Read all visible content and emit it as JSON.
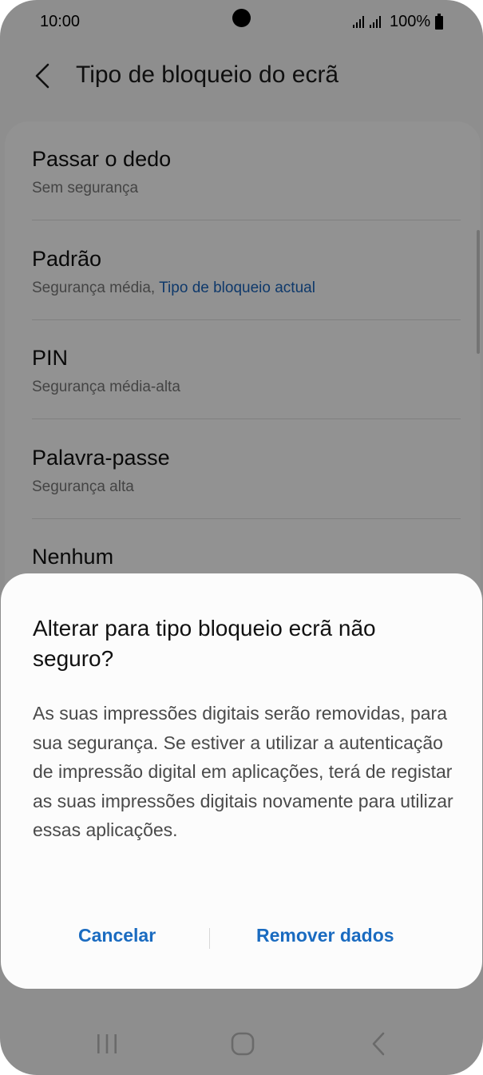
{
  "status_bar": {
    "time": "10:00",
    "battery_text": "100%",
    "icons": [
      "camera-cutout",
      "signal-icon",
      "battery-icon"
    ]
  },
  "app_bar": {
    "title": "Tipo de bloqueio do ecrã",
    "back_icon": "chevron-left-icon"
  },
  "lock_types": [
    {
      "title": "Passar o dedo",
      "subtitle": "Sem segurança",
      "subtitle_highlight": ""
    },
    {
      "title": "Padrão",
      "subtitle": "Segurança média,",
      "subtitle_highlight": "Tipo de bloqueio actual"
    },
    {
      "title": "PIN",
      "subtitle": "Segurança média-alta",
      "subtitle_highlight": ""
    },
    {
      "title": "Palavra-passe",
      "subtitle": "Segurança alta",
      "subtitle_highlight": ""
    },
    {
      "title": "Nenhum",
      "subtitle": "",
      "subtitle_highlight": ""
    }
  ],
  "dialog": {
    "title": "Alterar para tipo bloqueio ecrã não seguro?",
    "message": "As suas impressões digitais serão removidas, para sua segurança. Se estiver a utilizar a autenticação de impressão digital em aplicações, terá de registar as suas impressões digitais novamente para utilizar essas aplicações.",
    "cancel_label": "Cancelar",
    "confirm_label": "Remover dados"
  },
  "nav_bar": {
    "icons": [
      "recents-icon",
      "home-icon",
      "back-icon"
    ]
  },
  "colors": {
    "accent": "#1a6bc0",
    "highlight_text": "#1a63b8",
    "overlay": "rgba(0,0,0,0.42)"
  }
}
